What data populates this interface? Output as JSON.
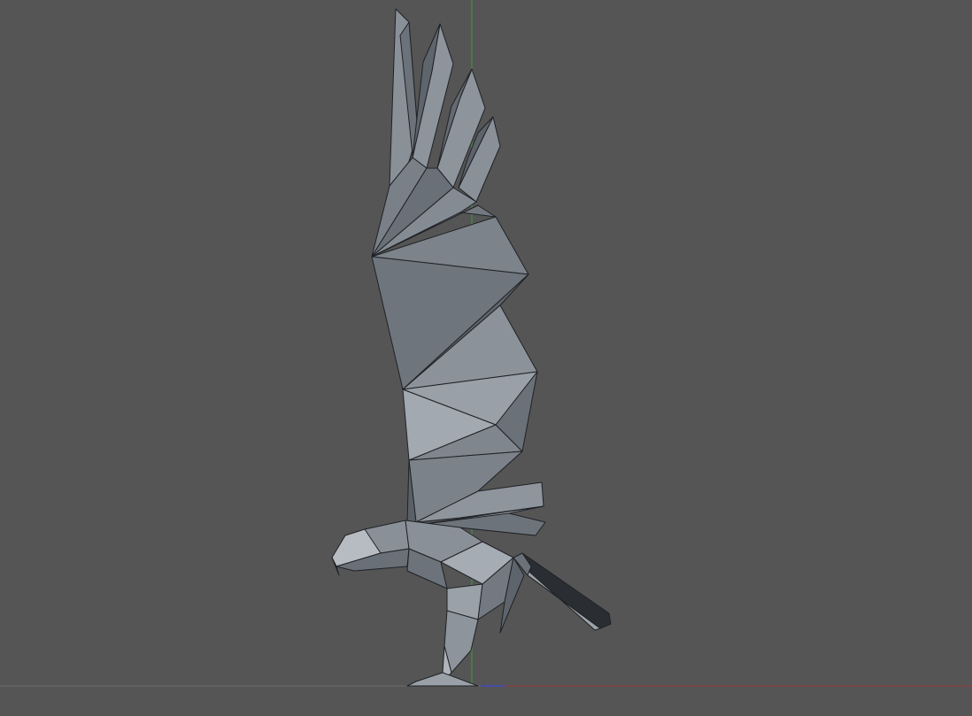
{
  "viewport": {
    "model": "low-poly eagle",
    "background_color": "#555555",
    "axis_colors": {
      "x": "#9b3a3a",
      "y": "#3a9b3a",
      "z": "#4a4aa8",
      "ground": "#6a6a6a"
    }
  }
}
